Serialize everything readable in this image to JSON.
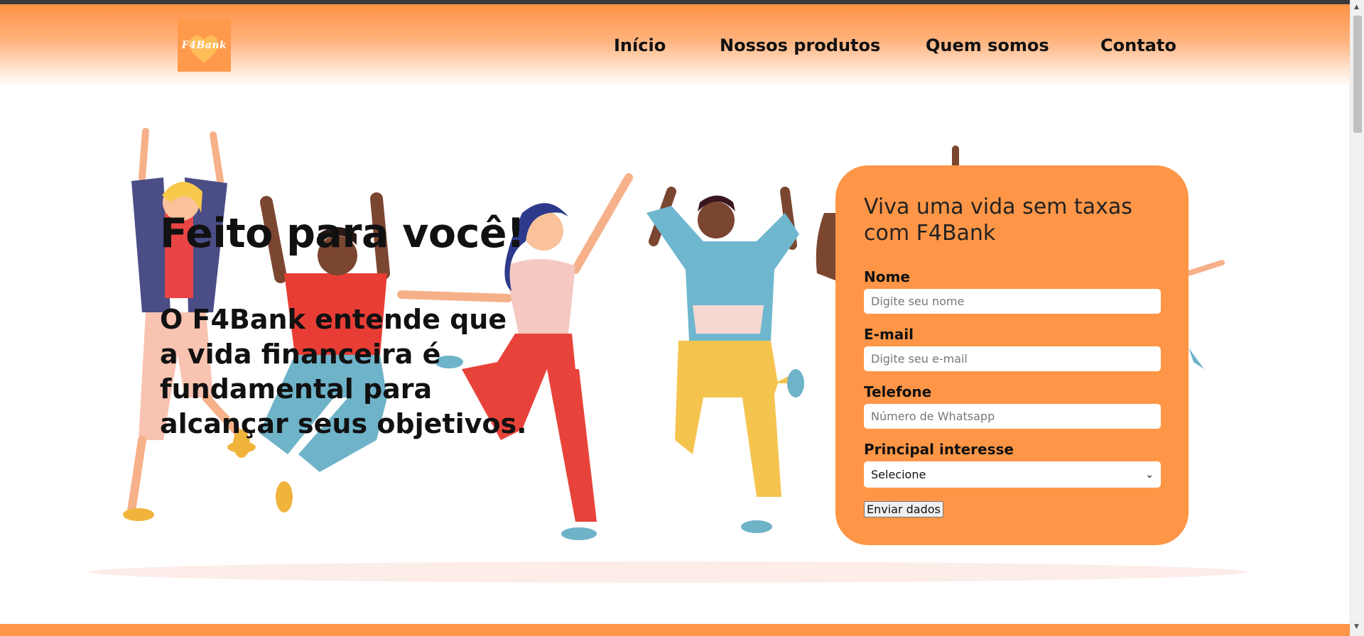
{
  "brand": {
    "logo_text": "F4Bank"
  },
  "nav": {
    "items": [
      {
        "label": "Início"
      },
      {
        "label": "Nossos produtos"
      },
      {
        "label": "Quem somos"
      },
      {
        "label": "Contato"
      }
    ]
  },
  "hero": {
    "title": "Feito para você!",
    "text": "O F4Bank entende que a vida financeira é fundamental para alcançar seus objetivos."
  },
  "form": {
    "title": "Viva uma vida sem taxas com F4Bank",
    "name_label": "Nome",
    "name_placeholder": "Digite seu nome",
    "email_label": "E-mail",
    "email_placeholder": "Digite seu e-mail",
    "phone_label": "Telefone",
    "phone_placeholder": "Número de Whatsapp",
    "interest_label": "Principal interesse",
    "interest_selected": "Selecione",
    "submit_label": "Enviar dados"
  },
  "icons": {
    "logo": "heart-logo-icon",
    "select_chevron": "chevron-down-icon"
  },
  "colors": {
    "accent": "#ff9647",
    "header_top": "#ff9245",
    "text": "#111111"
  }
}
